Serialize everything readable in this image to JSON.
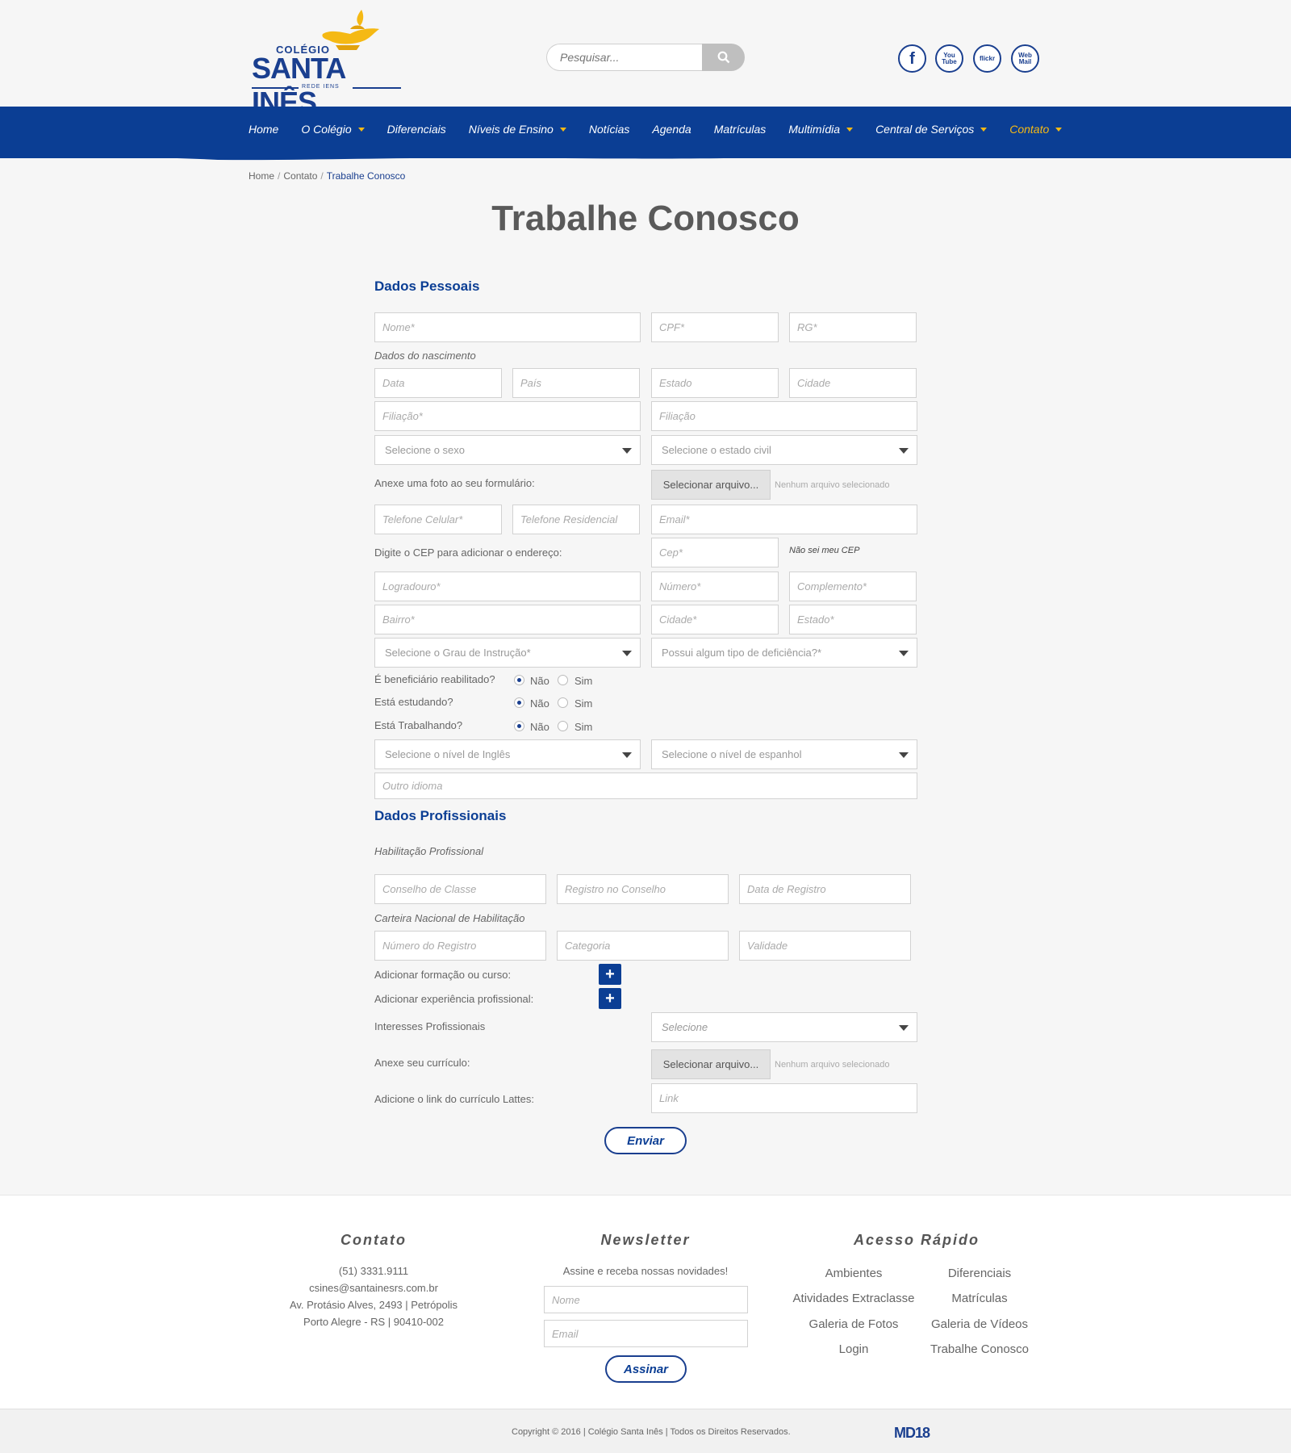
{
  "header": {
    "logo": {
      "top": "COLÉGIO",
      "name": "SANTA INÊS",
      "sub": "REDE   IENS"
    },
    "search": {
      "placeholder": "Pesquisar..."
    },
    "social": [
      "f",
      "You Tube",
      "flickr",
      "Web Mail"
    ]
  },
  "nav": {
    "items": [
      {
        "label": "Home",
        "caret": false
      },
      {
        "label": "O Colégio",
        "caret": true
      },
      {
        "label": "Diferenciais",
        "caret": false
      },
      {
        "label": "Níveis de Ensino",
        "caret": true
      },
      {
        "label": "Notícias",
        "caret": false
      },
      {
        "label": "Agenda",
        "caret": false
      },
      {
        "label": "Matrículas",
        "caret": false
      },
      {
        "label": "Multimídia",
        "caret": true
      },
      {
        "label": "Central de Serviços",
        "caret": true
      },
      {
        "label": "Contato",
        "caret": true
      }
    ]
  },
  "breadcrumb": {
    "home": "Home",
    "contato": "Contato",
    "current": "Trabalhe Conosco"
  },
  "page_title": "Trabalhe Conosco",
  "personal": {
    "title": "Dados Pessoais",
    "nome": "Nome*",
    "cpf": "CPF*",
    "rg": "RG*",
    "nascimento_label": "Dados do nascimento",
    "data": "Data",
    "pais": "País",
    "estado": "Estado",
    "cidade": "Cidade",
    "filiacao1": "Filiação*",
    "filiacao2": "Filiação",
    "sexo": "Selecione o sexo",
    "estado_civil": "Selecione o estado civil",
    "foto_label": "Anexe uma foto ao seu formulário:",
    "file_button": "Selecionar arquivo...",
    "file_none": "Nenhum arquivo selecionado",
    "cel": "Telefone Celular*",
    "res": "Telefone Residencial",
    "email": "Email*",
    "cep_label": "Digite o CEP para adicionar o endereço:",
    "cep": "Cep*",
    "cep_help": "Não sei meu CEP",
    "logradouro": "Logradouro*",
    "numero": "Número*",
    "complemento": "Complemento*",
    "bairro": "Bairro*",
    "cidade2": "Cidade*",
    "estado2": "Estado*",
    "grau": "Selecione o Grau de Instrução*",
    "deficiencia": "Possui algum tipo de deficiência?*",
    "q1": "É beneficiário reabilitado?",
    "q2": "Está estudando?",
    "q3": "Está Trabalhando?",
    "nao": "Não",
    "sim": "Sim",
    "ingles": "Selecione o nível de Inglês",
    "espanhol": "Selecione o nível de espanhol",
    "outro": "Outro idioma"
  },
  "professional": {
    "title": "Dados Profissionais",
    "habilitacao": "Habilitação Profissional",
    "conselho": "Conselho de Classe",
    "registro": "Registro no Conselho",
    "data_registro": "Data de Registro",
    "cnh": "Carteira Nacional de Habilitação",
    "num_registro": "Número do Registro",
    "categoria": "Categoria",
    "validade": "Validade",
    "add_formacao": "Adicionar formação ou curso:",
    "add_exp": "Adicionar experiência profissional:",
    "interesses": "Interesses Profissionais",
    "selecione": "Selecione",
    "curriculo": "Anexe seu currículo:",
    "lattes": "Adicione o link do currículo Lattes:",
    "link": "Link",
    "enviar": "Enviar"
  },
  "footer": {
    "contato_title": "Contato",
    "phone": "(51) 3331.9111",
    "email": "csines@santainesrs.com.br",
    "addr1": "Av. Protásio Alves, 2493 | Petrópolis",
    "addr2": "Porto Alegre - RS | 90410-002",
    "news_title": "Newsletter",
    "news_text": "Assine e receba nossas novidades!",
    "news_nome": "Nome",
    "news_email": "Email",
    "assinar": "Assinar",
    "acesso_title": "Acesso Rápido",
    "links": [
      "Ambientes",
      "Diferenciais",
      "Atividades Extraclasse",
      "Matrículas",
      "Galeria de Fotos",
      "Galeria de Vídeos",
      "Login",
      "Trabalhe Conosco"
    ],
    "copyright": "Copyright © 2016 | Colégio Santa Inês | Todos os Direitos Reservados.",
    "agency": "MD18"
  },
  "colors": {
    "primary": "#0b3e94",
    "accent": "#f5b914"
  }
}
